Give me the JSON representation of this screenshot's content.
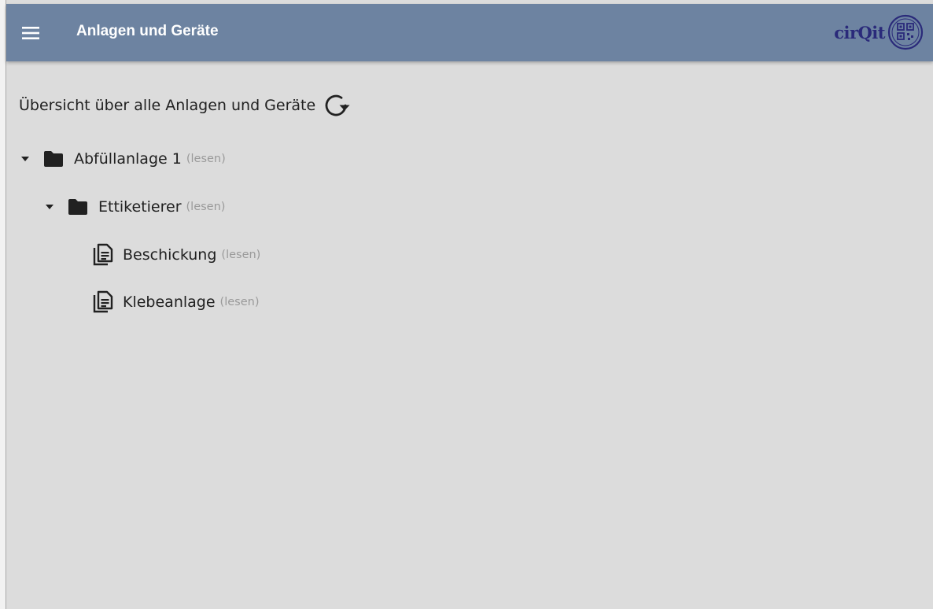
{
  "appbar": {
    "title": "Anlagen und Geräte",
    "logo_text": "cirQit",
    "background": "#6d83a1"
  },
  "content": {
    "heading": "Übersicht über alle Anlagen und Geräte"
  },
  "tree": [
    {
      "label": "Abfüllanlage 1",
      "permission": "(lesen)",
      "type": "folder",
      "expanded": true,
      "depth": 0
    },
    {
      "label": "Ettiketierer",
      "permission": "(lesen)",
      "type": "folder",
      "expanded": true,
      "depth": 1
    },
    {
      "label": "Beschickung",
      "permission": "(lesen)",
      "type": "document",
      "depth": 2
    },
    {
      "label": "Klebeanlage",
      "permission": "(lesen)",
      "type": "document",
      "depth": 2
    }
  ],
  "icons": {
    "menu": "menu-icon",
    "refresh": "refresh-icon",
    "expand": "caret-down-icon",
    "folder": "folder-icon",
    "document": "document-copy-icon"
  }
}
